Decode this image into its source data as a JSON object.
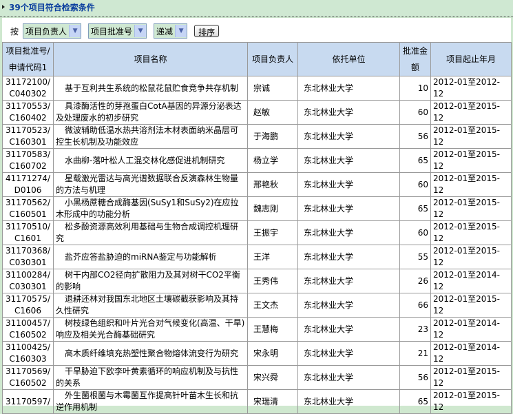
{
  "header": {
    "title": "39个项目符合检索条件"
  },
  "sort": {
    "label": "按",
    "field1": "项目负责人",
    "field2": "项目批准号",
    "order": "递减",
    "button": "排序"
  },
  "table": {
    "columns": [
      "项目批准号/申请代码1",
      "项目名称",
      "项目负责人",
      "依托单位",
      "批准金额",
      "项目起止年月"
    ],
    "rows": [
      {
        "code": "31172100/",
        "sub": "C040302",
        "name": "基于互利共生系统的松鼠花鼠贮食竞争共存机制",
        "person": "宗诚",
        "org": "东北林业大学",
        "amount": "10",
        "period": "2012-01至2012-12"
      },
      {
        "code": "31170553/",
        "sub": "C160402",
        "name": "具漆酶活性的芽孢蛋白CotA基因的异源分泌表达及处理废水的初步研究",
        "person": "赵敏",
        "org": "东北林业大学",
        "amount": "60",
        "period": "2012-01至2015-12"
      },
      {
        "code": "31170523/",
        "sub": "C160301",
        "name": "微波辅助低温水热共溶剂法木材表面纳米晶层可控生长机制及功能效应",
        "person": "于海鹏",
        "org": "东北林业大学",
        "amount": "56",
        "period": "2012-01至2015-12"
      },
      {
        "code": "31170583/",
        "sub": "C160702",
        "name": "水曲柳-落叶松人工混交林化感促进机制研究",
        "person": "杨立学",
        "org": "东北林业大学",
        "amount": "65",
        "period": "2012-01至2015-12"
      },
      {
        "code": "41171274/",
        "sub": "D0106",
        "name": "星载激光雷达与高光谱数据联合反演森林生物量的方法与机理",
        "person": "邢艳秋",
        "org": "东北林业大学",
        "amount": "60",
        "period": "2012-01至2015-12"
      },
      {
        "code": "31170562/",
        "sub": "C160501",
        "name": "小黑杨蔗糖合成酶基因(SuSy1和SuSy2)在应拉木形成中的功能分析",
        "person": "魏志刚",
        "org": "东北林业大学",
        "amount": "65",
        "period": "2012-01至2015-12"
      },
      {
        "code": "31170510/",
        "sub": "C1601",
        "name": "松多酚资源高效利用基础与生物合成调控机理研究",
        "person": "王振宇",
        "org": "东北林业大学",
        "amount": "60",
        "period": "2012-01至2015-12"
      },
      {
        "code": "31170368/",
        "sub": "C030301",
        "name": "盐芥应答盐胁迫的miRNA鉴定与功能解析",
        "person": "王洋",
        "org": "东北林业大学",
        "amount": "55",
        "period": "2012-01至2015-12"
      },
      {
        "code": "31100284/",
        "sub": "C030301",
        "name": "树干内部CO2径向扩散阻力及其对树干CO2平衡的影响",
        "person": "王秀伟",
        "org": "东北林业大学",
        "amount": "26",
        "period": "2012-01至2014-12"
      },
      {
        "code": "31170575/",
        "sub": "C1606",
        "name": "退耕还林对我国东北地区土壤碳截获影响及其持久性研究",
        "person": "王文杰",
        "org": "东北林业大学",
        "amount": "66",
        "period": "2012-01至2015-12"
      },
      {
        "code": "31100457/",
        "sub": "C160502",
        "name": "树枝绿色组织和叶片光合对气候变化(高温、干旱)响应及相关光合酶基础研究",
        "person": "王慧梅",
        "org": "东北林业大学",
        "amount": "23",
        "period": "2012-01至2014-12"
      },
      {
        "code": "31100425/",
        "sub": "C160303",
        "name": "高木质纤维填充热塑性聚合物熔体流变行为研究",
        "person": "宋永明",
        "org": "东北林业大学",
        "amount": "21",
        "period": "2012-01至2014-12"
      },
      {
        "code": "31170569/",
        "sub": "C160502",
        "name": "干旱胁迫下欧李叶黄素循环的响应机制及与抗性的关系",
        "person": "宋兴舜",
        "org": "东北林业大学",
        "amount": "56",
        "period": "2012-01至2015-12"
      },
      {
        "code": "31170597/",
        "sub": "",
        "name": "外生菌根菌与木霉菌互作提高针叶苗木生长和抗逆作用机制",
        "person": "宋瑞清",
        "org": "东北林业大学",
        "amount": "65",
        "period": "2012-01至2015-12"
      }
    ]
  }
}
